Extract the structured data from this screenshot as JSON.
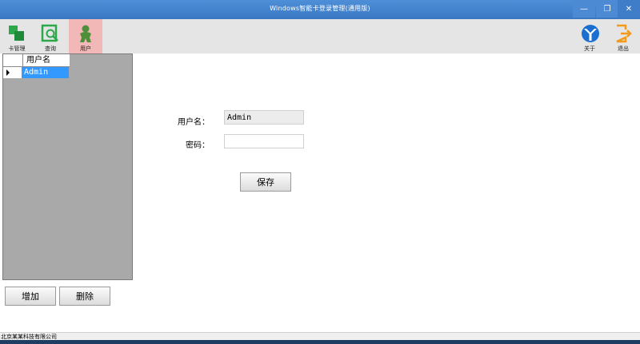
{
  "window": {
    "title": "Windows智能卡登录管理(通用版)",
    "minimize_glyph": "—",
    "maximize_glyph": "❐",
    "close_glyph": "✕"
  },
  "toolbar": {
    "items": [
      {
        "label": "卡管理",
        "icon": "card-manage-icon",
        "color": "#2aa84a"
      },
      {
        "label": "查询",
        "icon": "query-icon",
        "color": "#2aa84a"
      },
      {
        "label": "用户",
        "icon": "user-icon",
        "color": "#4f8f3a"
      },
      {
        "label": "关于",
        "icon": "about-icon",
        "color": "#1b6fd1"
      },
      {
        "label": "退出",
        "icon": "exit-icon",
        "color": "#f39a1d"
      }
    ],
    "active_color": "#f2b7b7"
  },
  "grid": {
    "column_header": "用户名",
    "rows": [
      {
        "name": "Admin"
      }
    ],
    "selected_color": "#3399ff"
  },
  "form": {
    "username_label": "用户名：",
    "username_value": "Admin",
    "password_label": "密码：",
    "password_value": "",
    "save_label": "保存"
  },
  "actions": {
    "add_label": "增加",
    "delete_label": "删除"
  },
  "status": {
    "text": "北京某某科技有限公司"
  }
}
